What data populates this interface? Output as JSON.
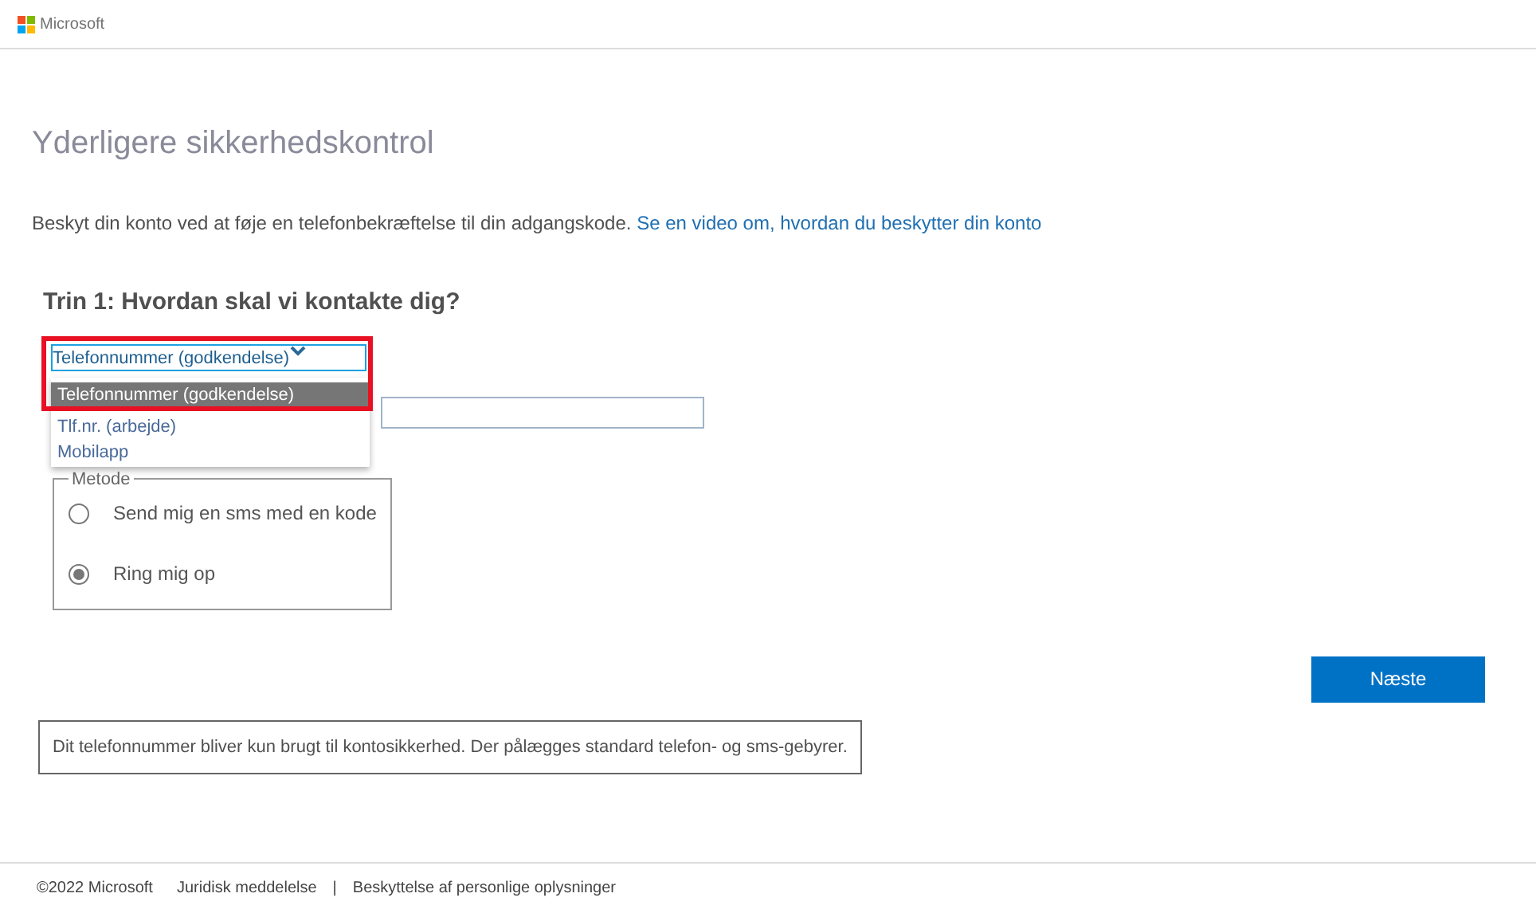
{
  "header": {
    "brand": "Microsoft"
  },
  "title": "Yderligere sikkerhedskontrol",
  "intro": {
    "text": "Beskyt din konto ved at føje en telefonbekræftelse til din adgangskode.",
    "link": "Se en video om, hvordan du beskytter din konto"
  },
  "step_heading": "Trin 1: Hvordan skal vi kontakte dig?",
  "contact_select": {
    "value": "Telefonnummer (godkendelse)",
    "expanded": true,
    "options": [
      {
        "label": "Telefonnummer (godkendelse)",
        "selected": true
      },
      {
        "label": "Tlf.nr. (arbejde)",
        "selected": false
      },
      {
        "label": "Mobilapp",
        "selected": false
      }
    ]
  },
  "method": {
    "legend": "Metode",
    "options": [
      {
        "label": "Send mig en sms med en kode",
        "selected": false
      },
      {
        "label": "Ring mig op",
        "selected": true
      }
    ]
  },
  "next_button": "Næste",
  "notice": "Dit telefonnummer bliver kun brugt til kontosikkerhed. Der pålægges standard telefon- og sms-gebyrer.",
  "footer": {
    "copyright": "©2022 Microsoft",
    "links": [
      "Juridisk meddelelse",
      "Beskyttelse af personlige oplysninger"
    ],
    "separator": "|"
  }
}
